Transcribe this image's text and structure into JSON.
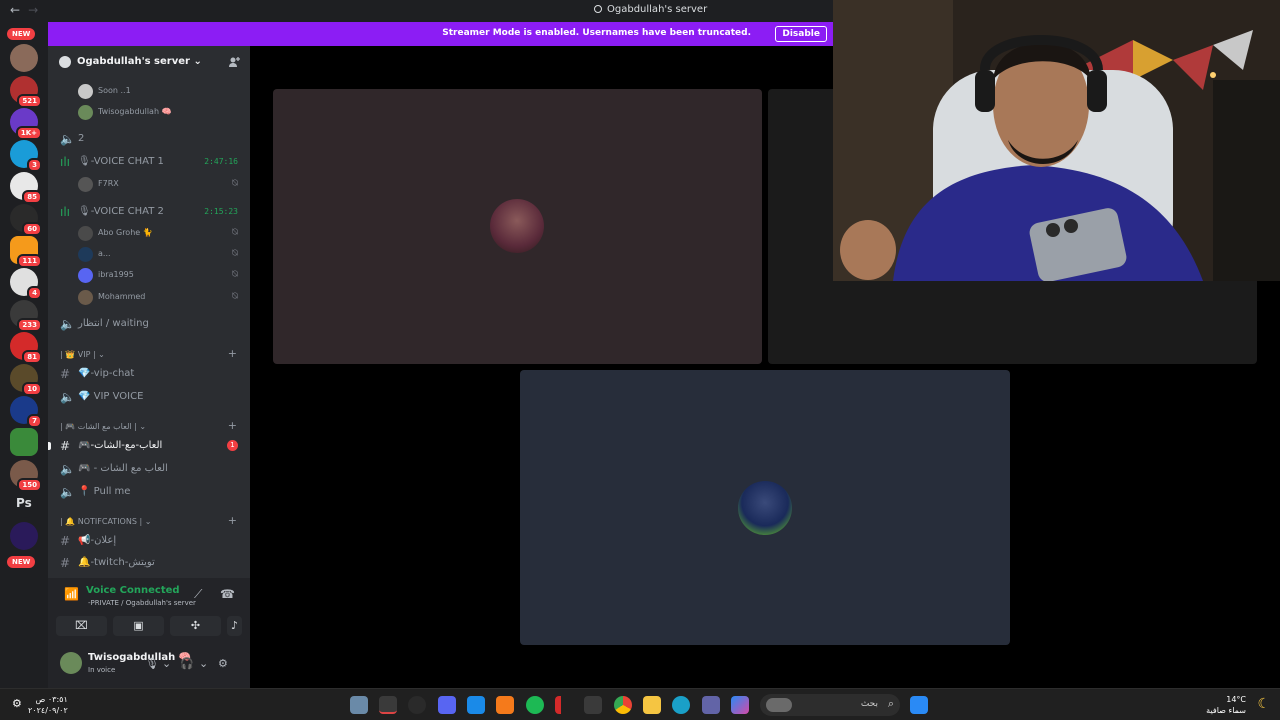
{
  "titlebar": {
    "title": "Ogabdullah's server",
    "back": "←",
    "forward": "→"
  },
  "banner": {
    "message": "Streamer Mode is enabled. Usernames have been truncated.",
    "button": "Disable"
  },
  "rail": {
    "new_top": "NEW",
    "new_bottom": "NEW",
    "servers": [
      {
        "badge": "",
        "color": "#8a6a5a"
      },
      {
        "badge": "521",
        "color": "#b03030"
      },
      {
        "badge": "1K+",
        "color": "#6a3ac8"
      },
      {
        "badge": "3",
        "color": "#1a9cd8"
      },
      {
        "badge": "85",
        "color": "#e8e8e8"
      },
      {
        "badge": "60",
        "color": "#2a2a2a"
      },
      {
        "badge": "111",
        "color": "#f59a1b"
      },
      {
        "badge": "4",
        "color": "#e0e0e0"
      },
      {
        "badge": "233",
        "color": "#3a3a3a"
      },
      {
        "badge": "81",
        "color": "#d42a2a"
      },
      {
        "badge": "10",
        "color": "#5a4a2a"
      },
      {
        "badge": "7",
        "color": "#1a3a8a"
      },
      {
        "badge": "",
        "color": "#3a8a3a"
      },
      {
        "badge": "150",
        "color": "#7a5a4a"
      },
      {
        "badge": "",
        "color": "#1e1f22",
        "text": "Ps"
      },
      {
        "badge": "",
        "color": "#2a1a5a"
      }
    ]
  },
  "sidebar": {
    "server_name": "Ogabdullah's server",
    "top_users": [
      {
        "name": "Soon ..1"
      },
      {
        "name": "Twisogabdullah 🧠"
      }
    ],
    "channel_2": "2",
    "voice_chat_1": {
      "name": "🎙-VOICE CHAT 1",
      "time": "2:47:16",
      "users": [
        {
          "name": "F7RX"
        }
      ]
    },
    "voice_chat_2": {
      "name": "🎙-VOICE CHAT 2",
      "time": "2:15:23",
      "users": [
        {
          "name": "Abo Grohe 🐈"
        },
        {
          "name": "a..."
        },
        {
          "name": "ibra1995"
        },
        {
          "name": "Mohammed"
        }
      ]
    },
    "waiting": "انتظار / waiting",
    "cat_vip": "| 👑 VIP |",
    "vip_chat": "💎-vip-chat",
    "vip_voice": "💎 VIP VOICE",
    "cat_games": "| 🎮 العاب مع الشات |",
    "games_text": "🎮-العاب-مع-الشات",
    "games_unread": "1",
    "games_voice": "🎮 - العاب مع الشات",
    "pull_me": "📍 Pull me",
    "cat_notif": "| 🔔 NOTIFCATIONS |",
    "announce": "📢-إعلان",
    "twitch": "🔔-twitch-تويتش"
  },
  "voice_panel": {
    "status": "Voice Connected",
    "location": "-PRIVATE / Ogabdullah's server",
    "user_name": "Twisogabdullah 🧠",
    "user_status": "In voice"
  },
  "taskbar": {
    "time": "٠٣:٥١ ص",
    "date": "٢٠٢٤/٠٩/٠٢",
    "search": "بحث",
    "temp": "14°C",
    "weather": "سماء صافية"
  },
  "colors": {
    "accent_purple": "#8c1df4",
    "voice_green": "#23a55a",
    "badge_red": "#f23f43",
    "tile_1": "#30272a",
    "tile_2": "#1b1b1b",
    "tile_3": "#272d3a"
  }
}
